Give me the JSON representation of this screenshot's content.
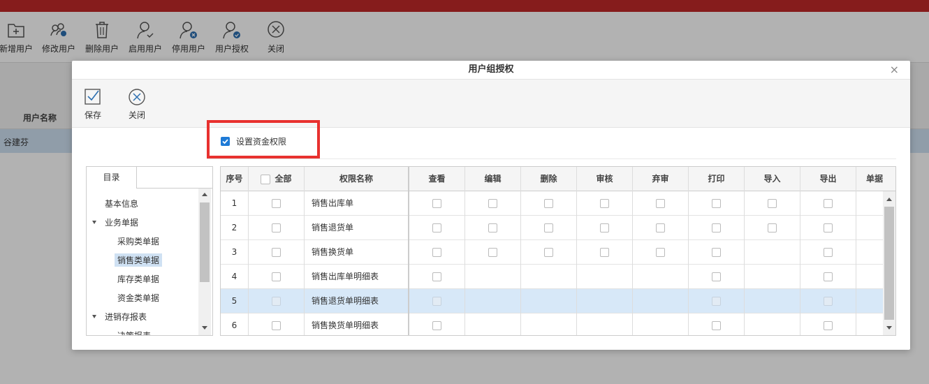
{
  "main_toolbar": {
    "buttons": [
      {
        "label": "新增用户",
        "icon": "add-folder-icon"
      },
      {
        "label": "修改用户",
        "icon": "edit-users-icon"
      },
      {
        "label": "删除用户",
        "icon": "trash-icon"
      },
      {
        "label": "启用用户",
        "icon": "user-enable-icon"
      },
      {
        "label": "停用用户",
        "icon": "user-disable-icon"
      },
      {
        "label": "用户授权",
        "icon": "user-authorize-icon"
      },
      {
        "label": "关闭",
        "icon": "close-circle-icon"
      }
    ]
  },
  "background_table": {
    "header": "用户名称",
    "row": "谷建芬"
  },
  "dialog": {
    "title": "用户组授权",
    "close": "×",
    "toolbar": {
      "save_label": "保存",
      "close_label": "关闭"
    },
    "fund_permission": {
      "label": "设置资金权限",
      "checked": true
    },
    "catalog": {
      "tab": "目录",
      "items": [
        {
          "label": "基本信息",
          "level": 0
        },
        {
          "label": "业务单据",
          "level": 0,
          "expanded": true
        },
        {
          "label": "采购类单据",
          "level": 1
        },
        {
          "label": "销售类单据",
          "level": 1,
          "selected": true
        },
        {
          "label": "库存类单据",
          "level": 1
        },
        {
          "label": "资金类单据",
          "level": 1
        },
        {
          "label": "进销存报表",
          "level": 0,
          "expanded": true
        },
        {
          "label": "决策报表",
          "level": 1
        }
      ]
    },
    "grid": {
      "columns": [
        "序号",
        "全部",
        "权限名称",
        "查看",
        "编辑",
        "删除",
        "审核",
        "弃审",
        "打印",
        "导入",
        "导出",
        "单据"
      ],
      "rows": [
        {
          "no": "1",
          "name": "销售出库单",
          "perms": [
            true,
            true,
            true,
            true,
            true,
            true,
            true,
            true
          ]
        },
        {
          "no": "2",
          "name": "销售退货单",
          "perms": [
            true,
            true,
            true,
            true,
            true,
            true,
            true,
            true
          ]
        },
        {
          "no": "3",
          "name": "销售换货单",
          "perms": [
            true,
            true,
            true,
            true,
            true,
            true,
            false,
            true
          ]
        },
        {
          "no": "4",
          "name": "销售出库单明细表",
          "perms": [
            true,
            false,
            false,
            false,
            false,
            true,
            false,
            true
          ]
        },
        {
          "no": "5",
          "name": "销售退货单明细表",
          "perms": [
            true,
            false,
            false,
            false,
            false,
            true,
            false,
            true
          ],
          "selected": true
        },
        {
          "no": "6",
          "name": "销售换货单明细表",
          "perms": [
            true,
            false,
            false,
            false,
            false,
            true,
            false,
            true
          ]
        }
      ]
    }
  }
}
